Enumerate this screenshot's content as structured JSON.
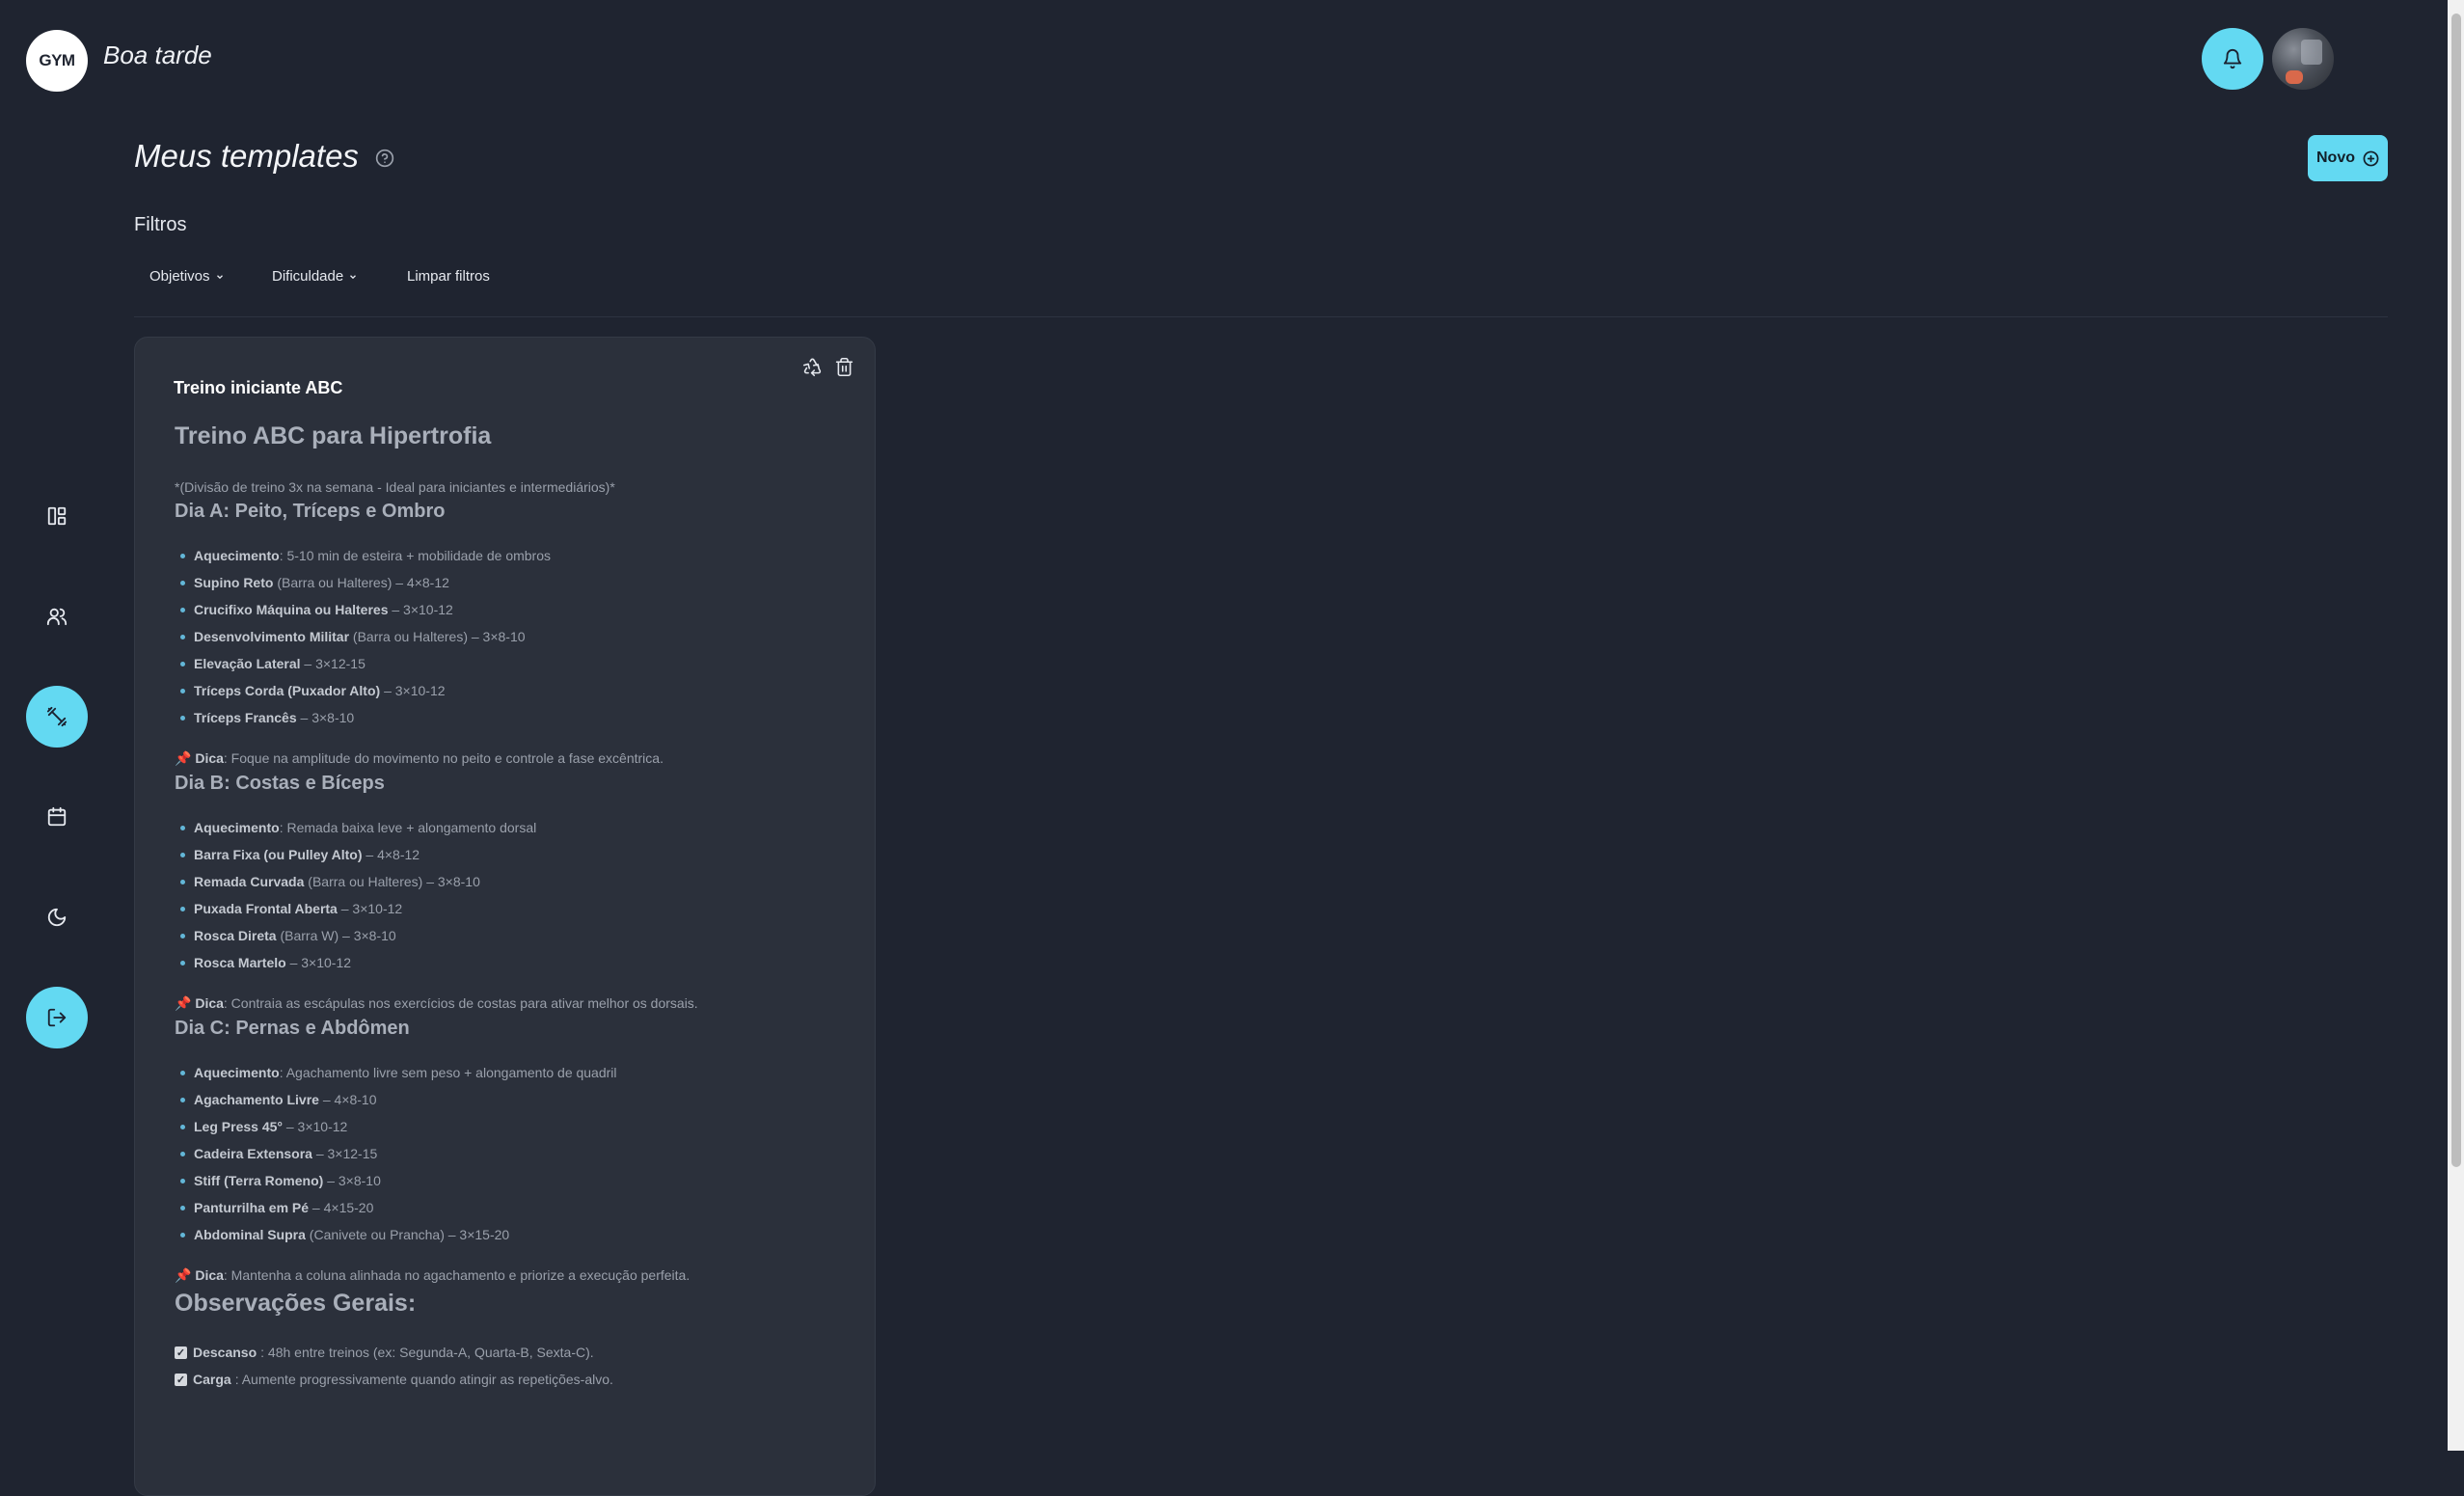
{
  "header": {
    "logo_text": "GYM",
    "greeting": "Boa tarde"
  },
  "icons": {
    "bell": "bell-icon",
    "dashboard": "dashboard-icon",
    "users": "users-icon",
    "workouts": "dumbbell-icon",
    "calendar": "calendar-icon",
    "theme": "moon-icon",
    "logout": "logout-icon",
    "help": "help-circle-icon",
    "recycle": "recycle-icon",
    "trash": "trash-icon"
  },
  "colors": {
    "accent": "#63d9f2",
    "background": "#1f2430",
    "card": "#2b303b"
  },
  "page": {
    "title": "Meus templates",
    "new_button": "Novo",
    "filters_label": "Filtros",
    "filters": [
      "Objetivos",
      "Dificuldade"
    ],
    "clear_filters": "Limpar filtros"
  },
  "card": {
    "name": "Treino iniciante ABC",
    "heading": "Treino ABC para Hipertrofia",
    "intro": "*(Divisão de treino 3x na semana - Ideal para iniciantes e intermediários)*",
    "days": [
      {
        "title": "Dia A: Peito, Tríceps e Ombro",
        "items": [
          {
            "name": "Aquecimento",
            "rest": ": 5-10 min de esteira + mobilidade de ombros"
          },
          {
            "name": "Supino Reto",
            "rest": " (Barra ou Halteres) – 4×8-12"
          },
          {
            "name": "Crucifixo Máquina ou Halteres",
            "rest": " – 3×10-12"
          },
          {
            "name": "Desenvolvimento Militar",
            "rest": " (Barra ou Halteres) – 3×8-10"
          },
          {
            "name": "Elevação Lateral",
            "rest": " – 3×12-15"
          },
          {
            "name": "Tríceps Corda (Puxador Alto)",
            "rest": " – 3×10-12"
          },
          {
            "name": "Tríceps Francês",
            "rest": " – 3×8-10"
          }
        ],
        "tip_label": "Dica",
        "tip": ": Foque na amplitude do movimento no peito e controle a fase excêntrica."
      },
      {
        "title": "Dia B: Costas e Bíceps",
        "items": [
          {
            "name": "Aquecimento",
            "rest": ": Remada baixa leve + alongamento dorsal"
          },
          {
            "name": "Barra Fixa (ou Pulley Alto)",
            "rest": " – 4×8-12"
          },
          {
            "name": "Remada Curvada",
            "rest": " (Barra ou Halteres) – 3×8-10"
          },
          {
            "name": "Puxada Frontal Aberta",
            "rest": " – 3×10-12"
          },
          {
            "name": "Rosca Direta",
            "rest": " (Barra W) – 3×8-10"
          },
          {
            "name": "Rosca Martelo",
            "rest": " – 3×10-12"
          }
        ],
        "tip_label": "Dica",
        "tip": ": Contraia as escápulas nos exercícios de costas para ativar melhor os dorsais."
      },
      {
        "title": "Dia C: Pernas e Abdômen",
        "items": [
          {
            "name": "Aquecimento",
            "rest": ": Agachamento livre sem peso + alongamento de quadril"
          },
          {
            "name": "Agachamento Livre",
            "rest": " – 4×8-10"
          },
          {
            "name": "Leg Press 45°",
            "rest": " – 3×10-12"
          },
          {
            "name": "Cadeira Extensora",
            "rest": " – 3×12-15"
          },
          {
            "name": "Stiff (Terra Romeno)",
            "rest": " – 3×8-10"
          },
          {
            "name": "Panturrilha em Pé",
            "rest": " – 4×15-20"
          },
          {
            "name": "Abdominal Supra",
            "rest": " (Canivete ou Prancha) – 3×15-20"
          }
        ],
        "tip_label": "Dica",
        "tip": ": Mantenha a coluna alinhada no agachamento e priorize a execução perfeita."
      }
    ],
    "observations_title": "Observações Gerais:",
    "observations": [
      {
        "label": "Descanso",
        "text": ": 48h entre treinos (ex: Segunda-A, Quarta-B, Sexta-C)."
      },
      {
        "label": "Carga",
        "text": ": Aumente progressivamente quando atingir as repetições-alvo."
      }
    ]
  }
}
